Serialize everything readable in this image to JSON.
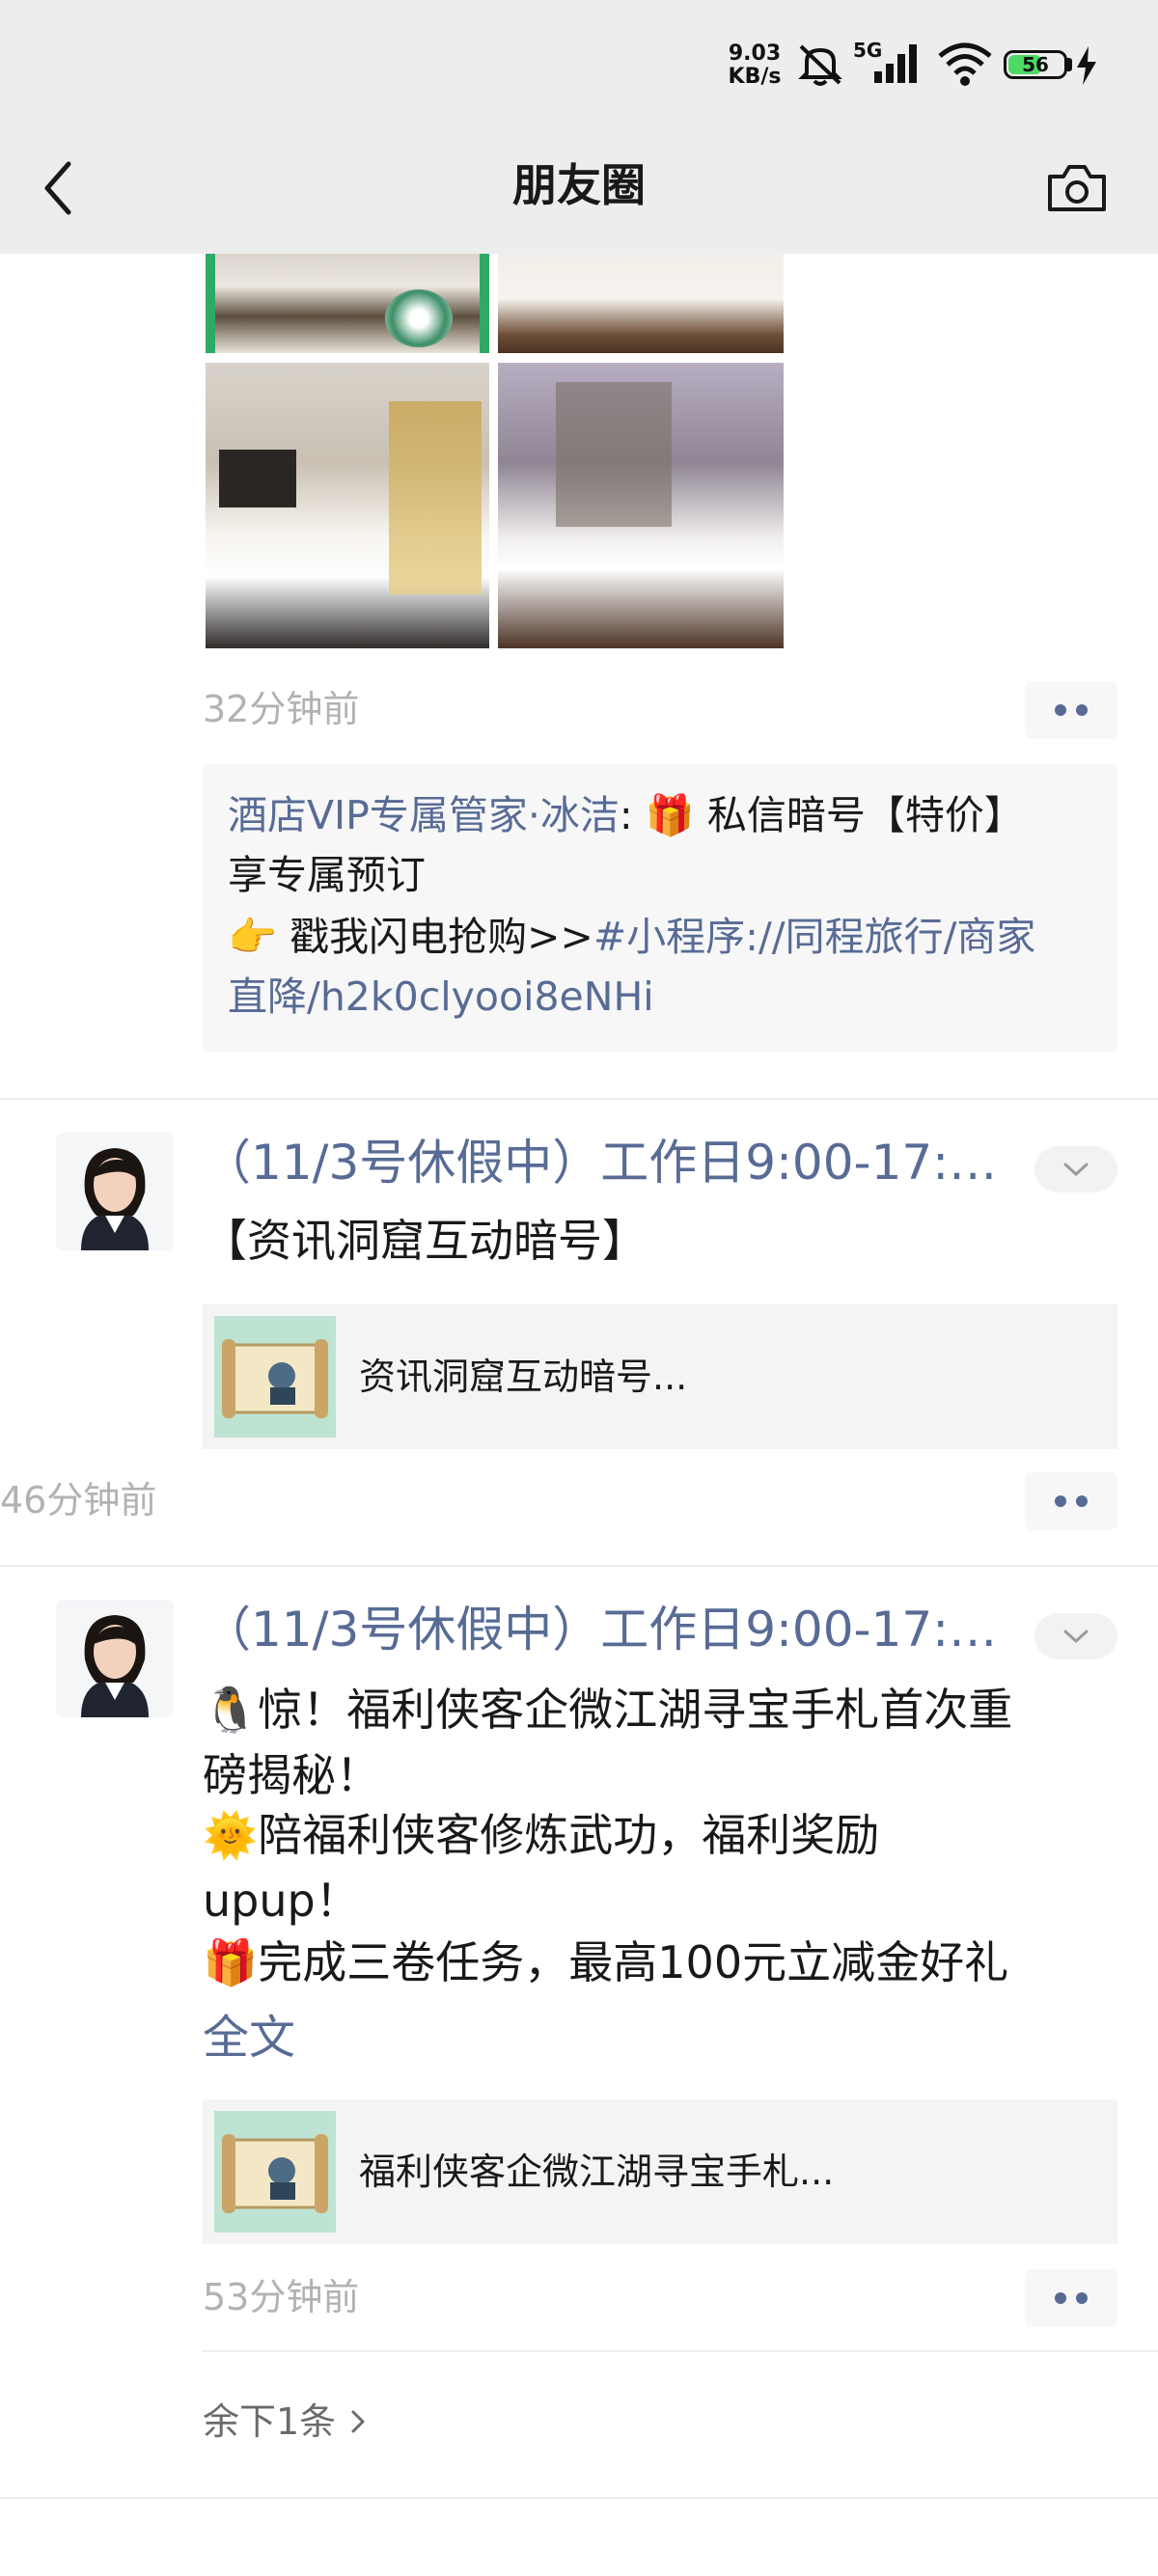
{
  "status_bar": {
    "net_speed_value": "9.03",
    "net_speed_unit": "KB/s",
    "network_type": "5G",
    "battery": "56"
  },
  "nav": {
    "title": "朋友圈",
    "back_icon": "chevron-left-icon",
    "camera_icon": "camera-icon"
  },
  "post1": {
    "time": "32分钟前",
    "comment": {
      "author": "酒店VIP专属管家·冰洁",
      "line1_text": "私信暗号【特价】",
      "line2": "享专属预订",
      "line3_text": "戳我闪电抢购>>",
      "line3_link": "#小程序://同程旅行/商家",
      "line4_link": "直降/h2k0clyooi8eNHi"
    }
  },
  "post2": {
    "name": "（11/3号休假中）工作日9:00-17:0...",
    "text": "【资讯洞窟互动暗号】",
    "link_title": "资讯洞窟互动暗号...",
    "time": "46分钟前"
  },
  "post3": {
    "name": "（11/3号休假中）工作日9:00-17:0...",
    "lines": [
      "惊！福利侠客企微江湖寻宝手札首次重",
      "磅揭秘！",
      "陪福利侠客修炼武功，福利奖励",
      "upup！",
      "完成三卷任务，最高100元立减金好礼"
    ],
    "full_text_label": "全文",
    "link_title": "福利侠客企微江湖寻宝手札...",
    "time": "53分钟前"
  },
  "footer": {
    "rest_label": "余下1条"
  },
  "colors": {
    "link_blue": "#576b95",
    "time_gray": "#b2b2b2",
    "nav_bg": "#ededed"
  }
}
